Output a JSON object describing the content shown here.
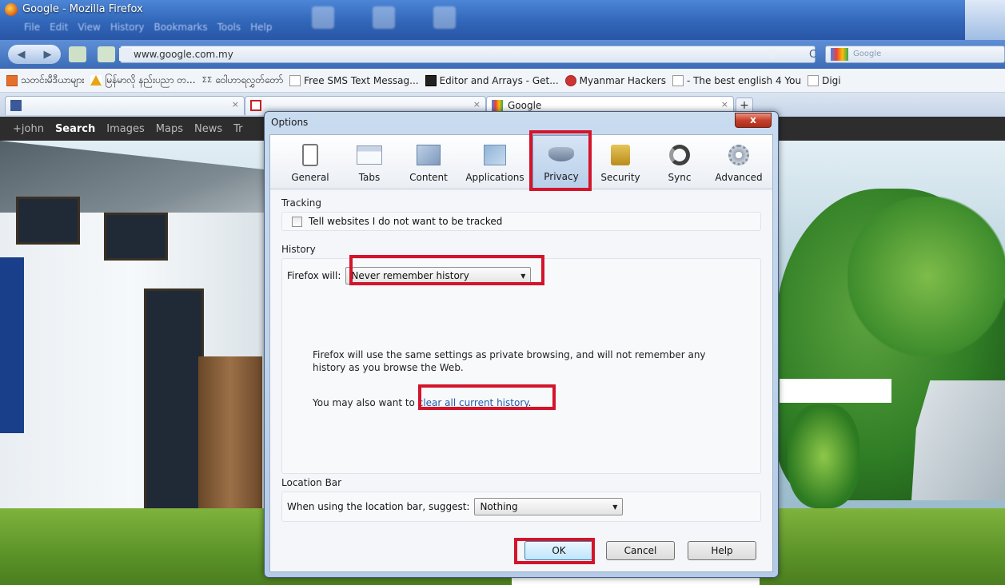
{
  "window": {
    "title": "Google - Mozilla Firefox",
    "menu": [
      "File",
      "Edit",
      "View",
      "History",
      "Bookmarks",
      "Tools",
      "Help"
    ]
  },
  "navbar": {
    "url": "www.google.com.my",
    "search_placeholder": "Google"
  },
  "bookmarks": [
    {
      "label": "သတင်းမီဒီယာများ",
      "icon": "orange-square"
    },
    {
      "label": "မြန်မာလို နည်းပညာ တ...",
      "icon": "triangle"
    },
    {
      "label": "ဝေါဟာရလွှတ်တော်",
      "icon": "text-logo"
    },
    {
      "label": "Free SMS Text Messag...",
      "icon": "page"
    },
    {
      "label": "Editor and Arrays - Get...",
      "icon": "dark-square"
    },
    {
      "label": "Myanmar Hackers",
      "icon": "red-circle"
    },
    {
      "label": "- The best english 4 You",
      "icon": "page"
    },
    {
      "label": "Digi",
      "icon": "page"
    }
  ],
  "tabs": [
    {
      "label": "",
      "icon": "facebook-icon"
    },
    {
      "label": "",
      "icon": "gmail-icon"
    },
    {
      "label": "Google",
      "icon": "google-icon"
    }
  ],
  "google_bar": {
    "items": [
      "+john",
      "Search",
      "Images",
      "Maps",
      "News",
      "Tr"
    ],
    "active": "Search"
  },
  "dialog": {
    "title": "Options",
    "close": "x",
    "panes": [
      {
        "label": "General",
        "icon": "general-icon"
      },
      {
        "label": "Tabs",
        "icon": "tabs-icon"
      },
      {
        "label": "Content",
        "icon": "content-icon"
      },
      {
        "label": "Applications",
        "icon": "applications-icon"
      },
      {
        "label": "Privacy",
        "icon": "privacy-mask-icon"
      },
      {
        "label": "Security",
        "icon": "padlock-icon"
      },
      {
        "label": "Sync",
        "icon": "sync-icon"
      },
      {
        "label": "Advanced",
        "icon": "gear-icon"
      }
    ],
    "selected_pane": "Privacy",
    "tracking": {
      "title": "Tracking",
      "checkbox_label": "Tell websites I do not want to be tracked",
      "checked": false
    },
    "history": {
      "title": "History",
      "label": "Firefox will:",
      "value": "Never remember history",
      "description": "Firefox will use the same settings as private browsing, and will not remember any history as you browse the Web.",
      "clear_prefix": "You may also want to ",
      "clear_link": "clear all current history",
      "clear_suffix": "."
    },
    "location_bar": {
      "title": "Location Bar",
      "label": "When using the location bar, suggest:",
      "value": "Nothing"
    },
    "buttons": {
      "ok": "OK",
      "cancel": "Cancel",
      "help": "Help"
    }
  },
  "colors": {
    "highlight": "#d4142a",
    "link": "#1f5ba8"
  }
}
